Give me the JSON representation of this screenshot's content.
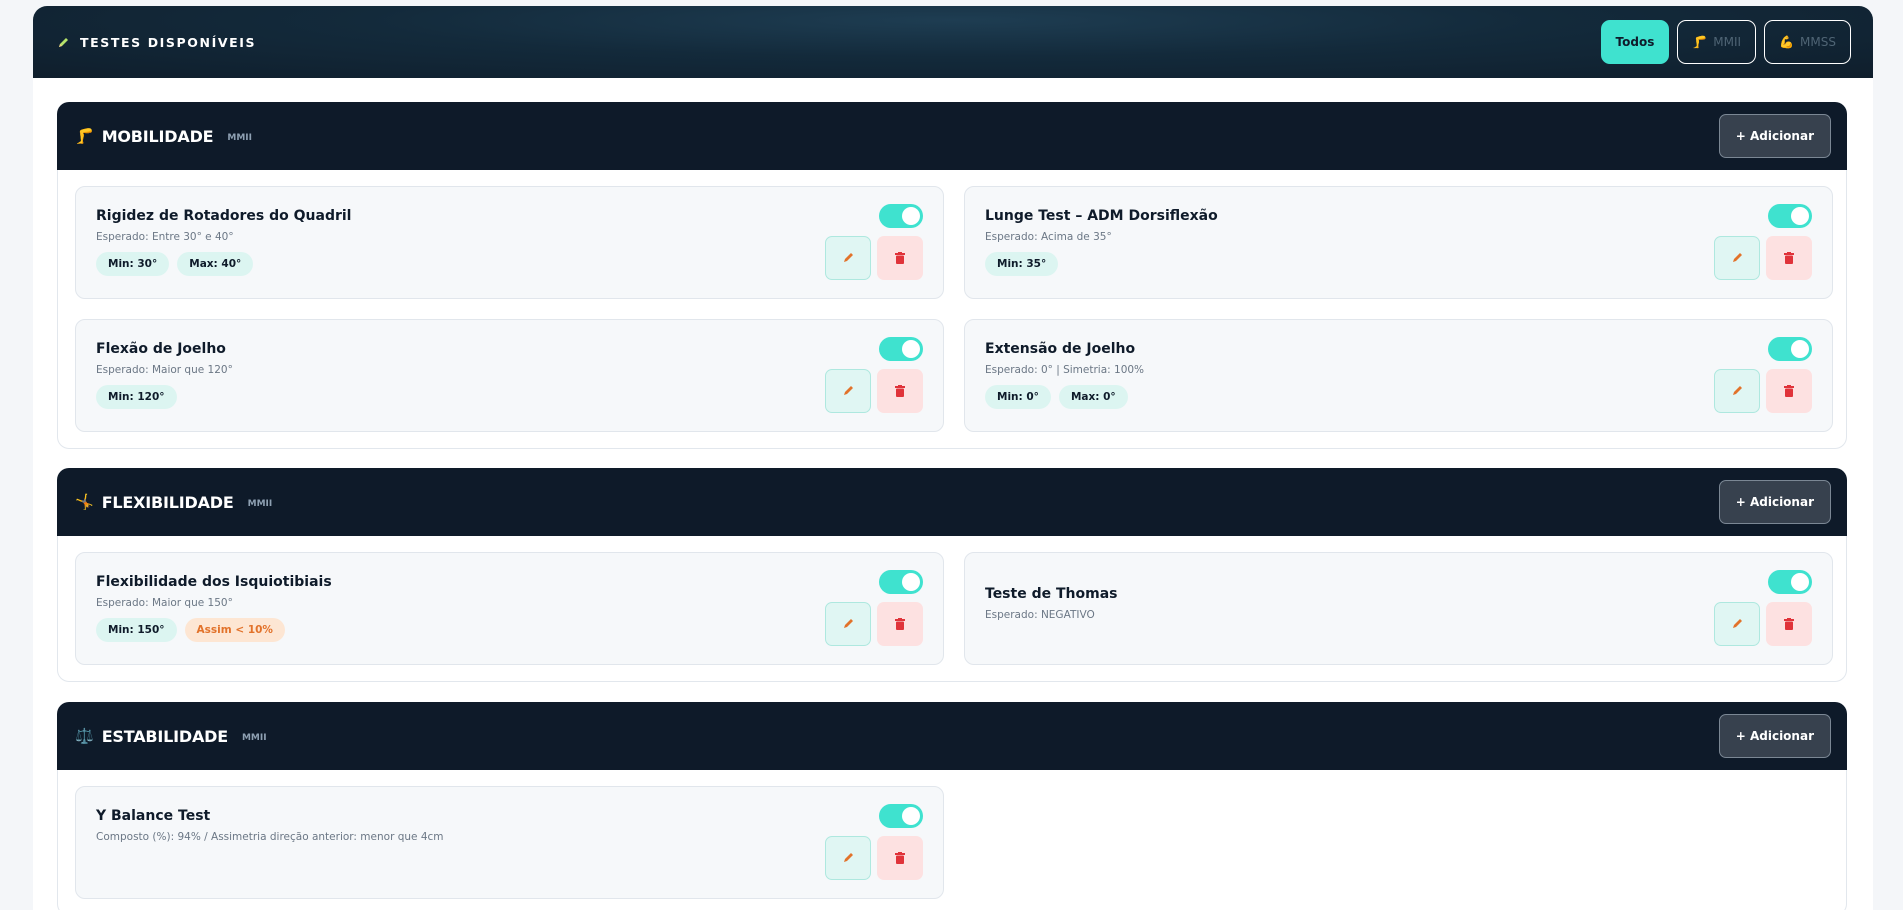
{
  "header": {
    "title": "TESTES DISPONÍVEIS",
    "filters": [
      {
        "label": "Todos",
        "icon": "",
        "active": true
      },
      {
        "label": "MMII",
        "icon": "🦵",
        "active": false
      },
      {
        "label": "MMSS",
        "icon": "💪",
        "active": false
      }
    ]
  },
  "colors": {
    "accent": "#3fe2cf",
    "header_bg": "#0e1a29",
    "pill_bg": "#dcf5f1",
    "warn_pill_bg": "#fde6d3",
    "delete_bg": "#fde1e1"
  },
  "add_label": "+ Adicionar",
  "sections": [
    {
      "icon": "🦵",
      "title": "MOBILIDADE",
      "tag": "MMII",
      "cards": [
        {
          "name": "Rigidez de Rotadores do Quadril",
          "desc": "Esperado: Entre 30° e 40°",
          "pills": [
            "Min: 30°",
            "Max: 40°"
          ],
          "enabled": true
        },
        {
          "name": "Lunge Test – ADM Dorsiflexão",
          "desc": "Esperado: Acima de 35°",
          "pills": [
            "Min: 35°"
          ],
          "enabled": true
        },
        {
          "name": "Flexão de Joelho",
          "desc": "Esperado: Maior que 120°",
          "pills": [
            "Min: 120°"
          ],
          "enabled": true
        },
        {
          "name": "Extensão de Joelho",
          "desc": "Esperado: 0° | Simetria: 100%",
          "pills": [
            "Min: 0°",
            "Max: 0°"
          ],
          "enabled": true
        }
      ]
    },
    {
      "icon": "🤸",
      "title": "FLEXIBILIDADE",
      "tag": "MMII",
      "cards": [
        {
          "name": "Flexibilidade dos Isquiotibiais",
          "desc": "Esperado: Maior que 150°",
          "pills": [
            "Min: 150°"
          ],
          "warn_pill": "Assim < 10%",
          "enabled": true
        },
        {
          "name": "Teste de Thomas",
          "desc": "Esperado: NEGATIVO",
          "pills": [],
          "enabled": true
        }
      ]
    },
    {
      "icon": "⚖️",
      "title": "ESTABILIDADE",
      "tag": "MMII",
      "cards": [
        {
          "name": "Y Balance Test",
          "desc": "Composto (%): 94% / Assimetria direção anterior: menor que 4cm",
          "pills": [],
          "enabled": true
        }
      ]
    }
  ]
}
